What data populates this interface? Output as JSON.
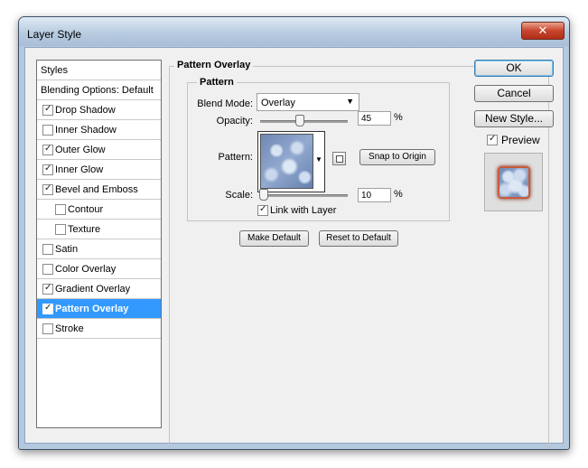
{
  "window": {
    "title": "Layer Style",
    "close_glyph": "✕"
  },
  "styles_list": {
    "header": "Styles",
    "blending": "Blending Options: Default",
    "items": [
      {
        "label": "Drop Shadow",
        "checked": true,
        "indent": false,
        "selected": false
      },
      {
        "label": "Inner Shadow",
        "checked": false,
        "indent": false,
        "selected": false
      },
      {
        "label": "Outer Glow",
        "checked": true,
        "indent": false,
        "selected": false
      },
      {
        "label": "Inner Glow",
        "checked": true,
        "indent": false,
        "selected": false
      },
      {
        "label": "Bevel and Emboss",
        "checked": true,
        "indent": false,
        "selected": false
      },
      {
        "label": "Contour",
        "checked": false,
        "indent": true,
        "selected": false
      },
      {
        "label": "Texture",
        "checked": false,
        "indent": true,
        "selected": false
      },
      {
        "label": "Satin",
        "checked": false,
        "indent": false,
        "selected": false
      },
      {
        "label": "Color Overlay",
        "checked": false,
        "indent": false,
        "selected": false
      },
      {
        "label": "Gradient Overlay",
        "checked": true,
        "indent": false,
        "selected": false
      },
      {
        "label": "Pattern Overlay",
        "checked": true,
        "indent": false,
        "selected": true
      },
      {
        "label": "Stroke",
        "checked": false,
        "indent": false,
        "selected": false
      }
    ]
  },
  "panel": {
    "title": "Pattern Overlay",
    "group": "Pattern",
    "blend_mode_label": "Blend Mode:",
    "blend_mode_value": "Overlay",
    "opacity_label": "Opacity:",
    "opacity_value": "45",
    "opacity_fraction": 0.45,
    "percent": "%",
    "pattern_label": "Pattern:",
    "snap_button": "Snap to Origin",
    "scale_label": "Scale:",
    "scale_value": "10",
    "scale_fraction": 0.0,
    "link_label": "Link with Layer",
    "link_checked": true,
    "make_default": "Make Default",
    "reset_default": "Reset to Default"
  },
  "actions": {
    "ok": "OK",
    "cancel": "Cancel",
    "new_style": "New Style...",
    "preview_label": "Preview",
    "preview_checked": true
  },
  "colors": {
    "selection": "#3399ff",
    "title_bg": "#b7cbe0",
    "close_red": "#c8452c"
  }
}
